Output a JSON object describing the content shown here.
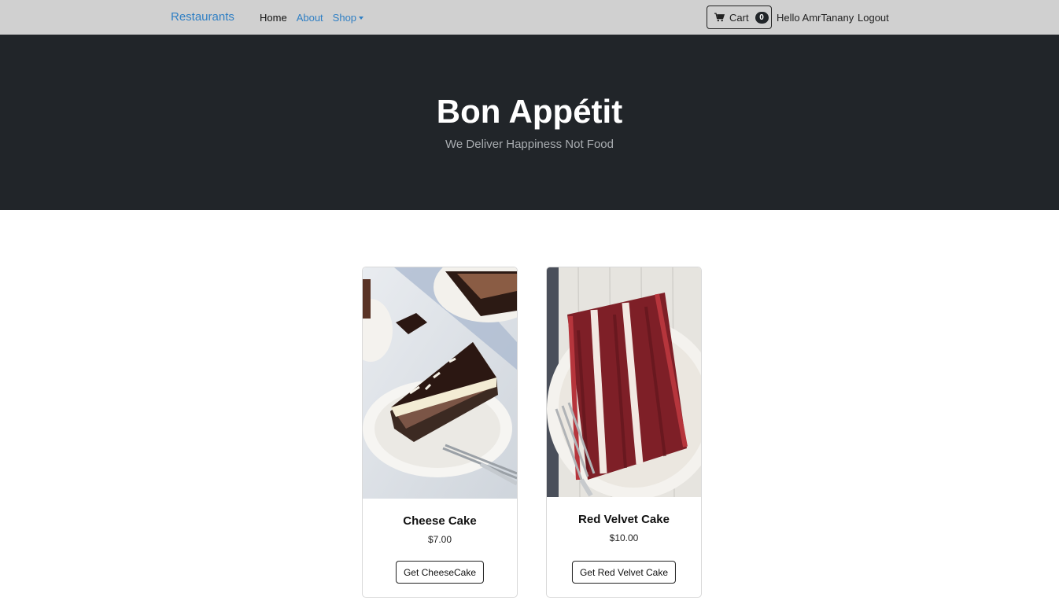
{
  "navbar": {
    "brand": "Restaurants",
    "links": [
      {
        "label": "Home"
      },
      {
        "label": "About"
      },
      {
        "label": "Shop"
      }
    ],
    "cart_label": "Cart",
    "cart_count": "0",
    "greeting": "Hello AmrTanany",
    "logout_label": "Logout"
  },
  "hero": {
    "title": "Bon Appétit",
    "subtitle": "We Deliver Happiness Not Food"
  },
  "products": [
    {
      "name": "Cheese Cake",
      "price": "$7.00",
      "button": "Get CheeseCake"
    },
    {
      "name": "Red Velvet Cake",
      "price": "$10.00",
      "button": "Get Red Velvet Cake"
    }
  ],
  "colors": {
    "navbar_bg": "#d0d0d0",
    "hero_bg": "#212529",
    "link": "#2f7fc4"
  }
}
